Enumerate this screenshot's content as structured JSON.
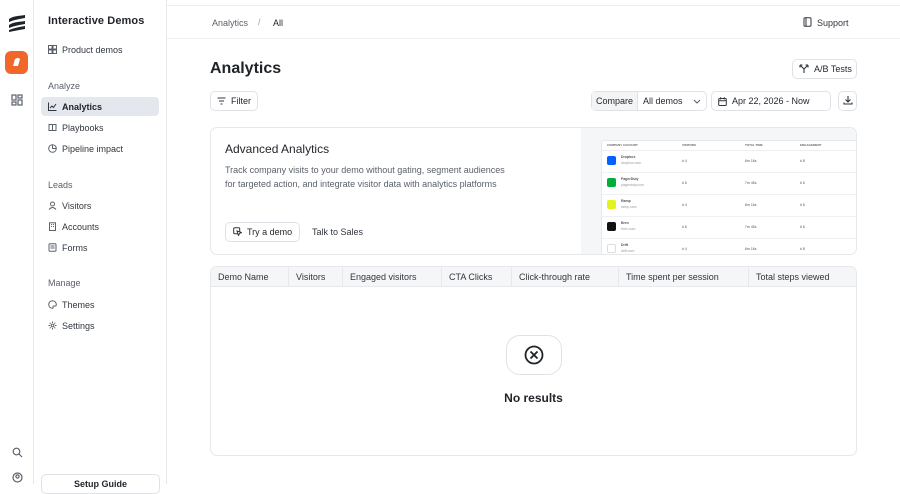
{
  "sidebar": {
    "brand": "Interactive Demos",
    "top_item": "Product demos",
    "sections": [
      {
        "title": "Analyze",
        "items": [
          "Analytics",
          "Playbooks",
          "Pipeline impact"
        ]
      },
      {
        "title": "Leads",
        "items": [
          "Visitors",
          "Accounts",
          "Forms"
        ]
      },
      {
        "title": "Manage",
        "items": [
          "Themes",
          "Settings"
        ]
      }
    ],
    "setup_label": "Setup Guide"
  },
  "breadcrumb": {
    "parent": "Analytics",
    "separator": "/",
    "current": "All"
  },
  "header": {
    "support_label": "Support",
    "title": "Analytics",
    "ab_tests_label": "A/B Tests"
  },
  "filters": {
    "filter_label": "Filter",
    "compare_label": "Compare",
    "compare_value": "All demos",
    "date_range": "Apr 22, 2026 - Now"
  },
  "promo": {
    "title": "Advanced Analytics",
    "description": "Track company visits to your demo without gating, segment audiences for targeted action, and integrate visitor data with analytics platforms",
    "try_label": "Try a demo",
    "talk_label": "Talk to Sales",
    "preview": {
      "headers": [
        "COMPANY ACCOUNT",
        "VISITORS",
        "TOTAL TIME",
        "ENGAGEMENT"
      ],
      "rows": [
        {
          "name": "Dropbox",
          "domain": "dropbox.com",
          "visitors": "# 4",
          "time": "8m 16s",
          "eng": "# 8",
          "color": "#0061fe"
        },
        {
          "name": "PagerDuty",
          "domain": "pagerduty.com",
          "visitors": "# 6",
          "time": "7m 45s",
          "eng": "# 6",
          "color": "#06ac38"
        },
        {
          "name": "Ramp",
          "domain": "ramp.com",
          "visitors": "# 4",
          "time": "8m 16s",
          "eng": "# 8",
          "color": "#e4f222"
        },
        {
          "name": "Brex",
          "domain": "brex.com",
          "visitors": "# 6",
          "time": "7m 45s",
          "eng": "# 6",
          "color": "#111111"
        },
        {
          "name": "Drift",
          "domain": "drift.com",
          "visitors": "# 4",
          "time": "8m 16s",
          "eng": "# 8",
          "color": "#ffffff"
        }
      ]
    }
  },
  "table": {
    "columns": [
      "Demo Name",
      "Visitors",
      "Engaged visitors",
      "CTA Clicks",
      "Click-through rate",
      "Time spent per session",
      "Total steps viewed"
    ],
    "empty_text": "No results"
  },
  "colors": {
    "accent": "#f0662b",
    "active_bg": "#e4e8ee",
    "border": "#e6e8eb"
  }
}
